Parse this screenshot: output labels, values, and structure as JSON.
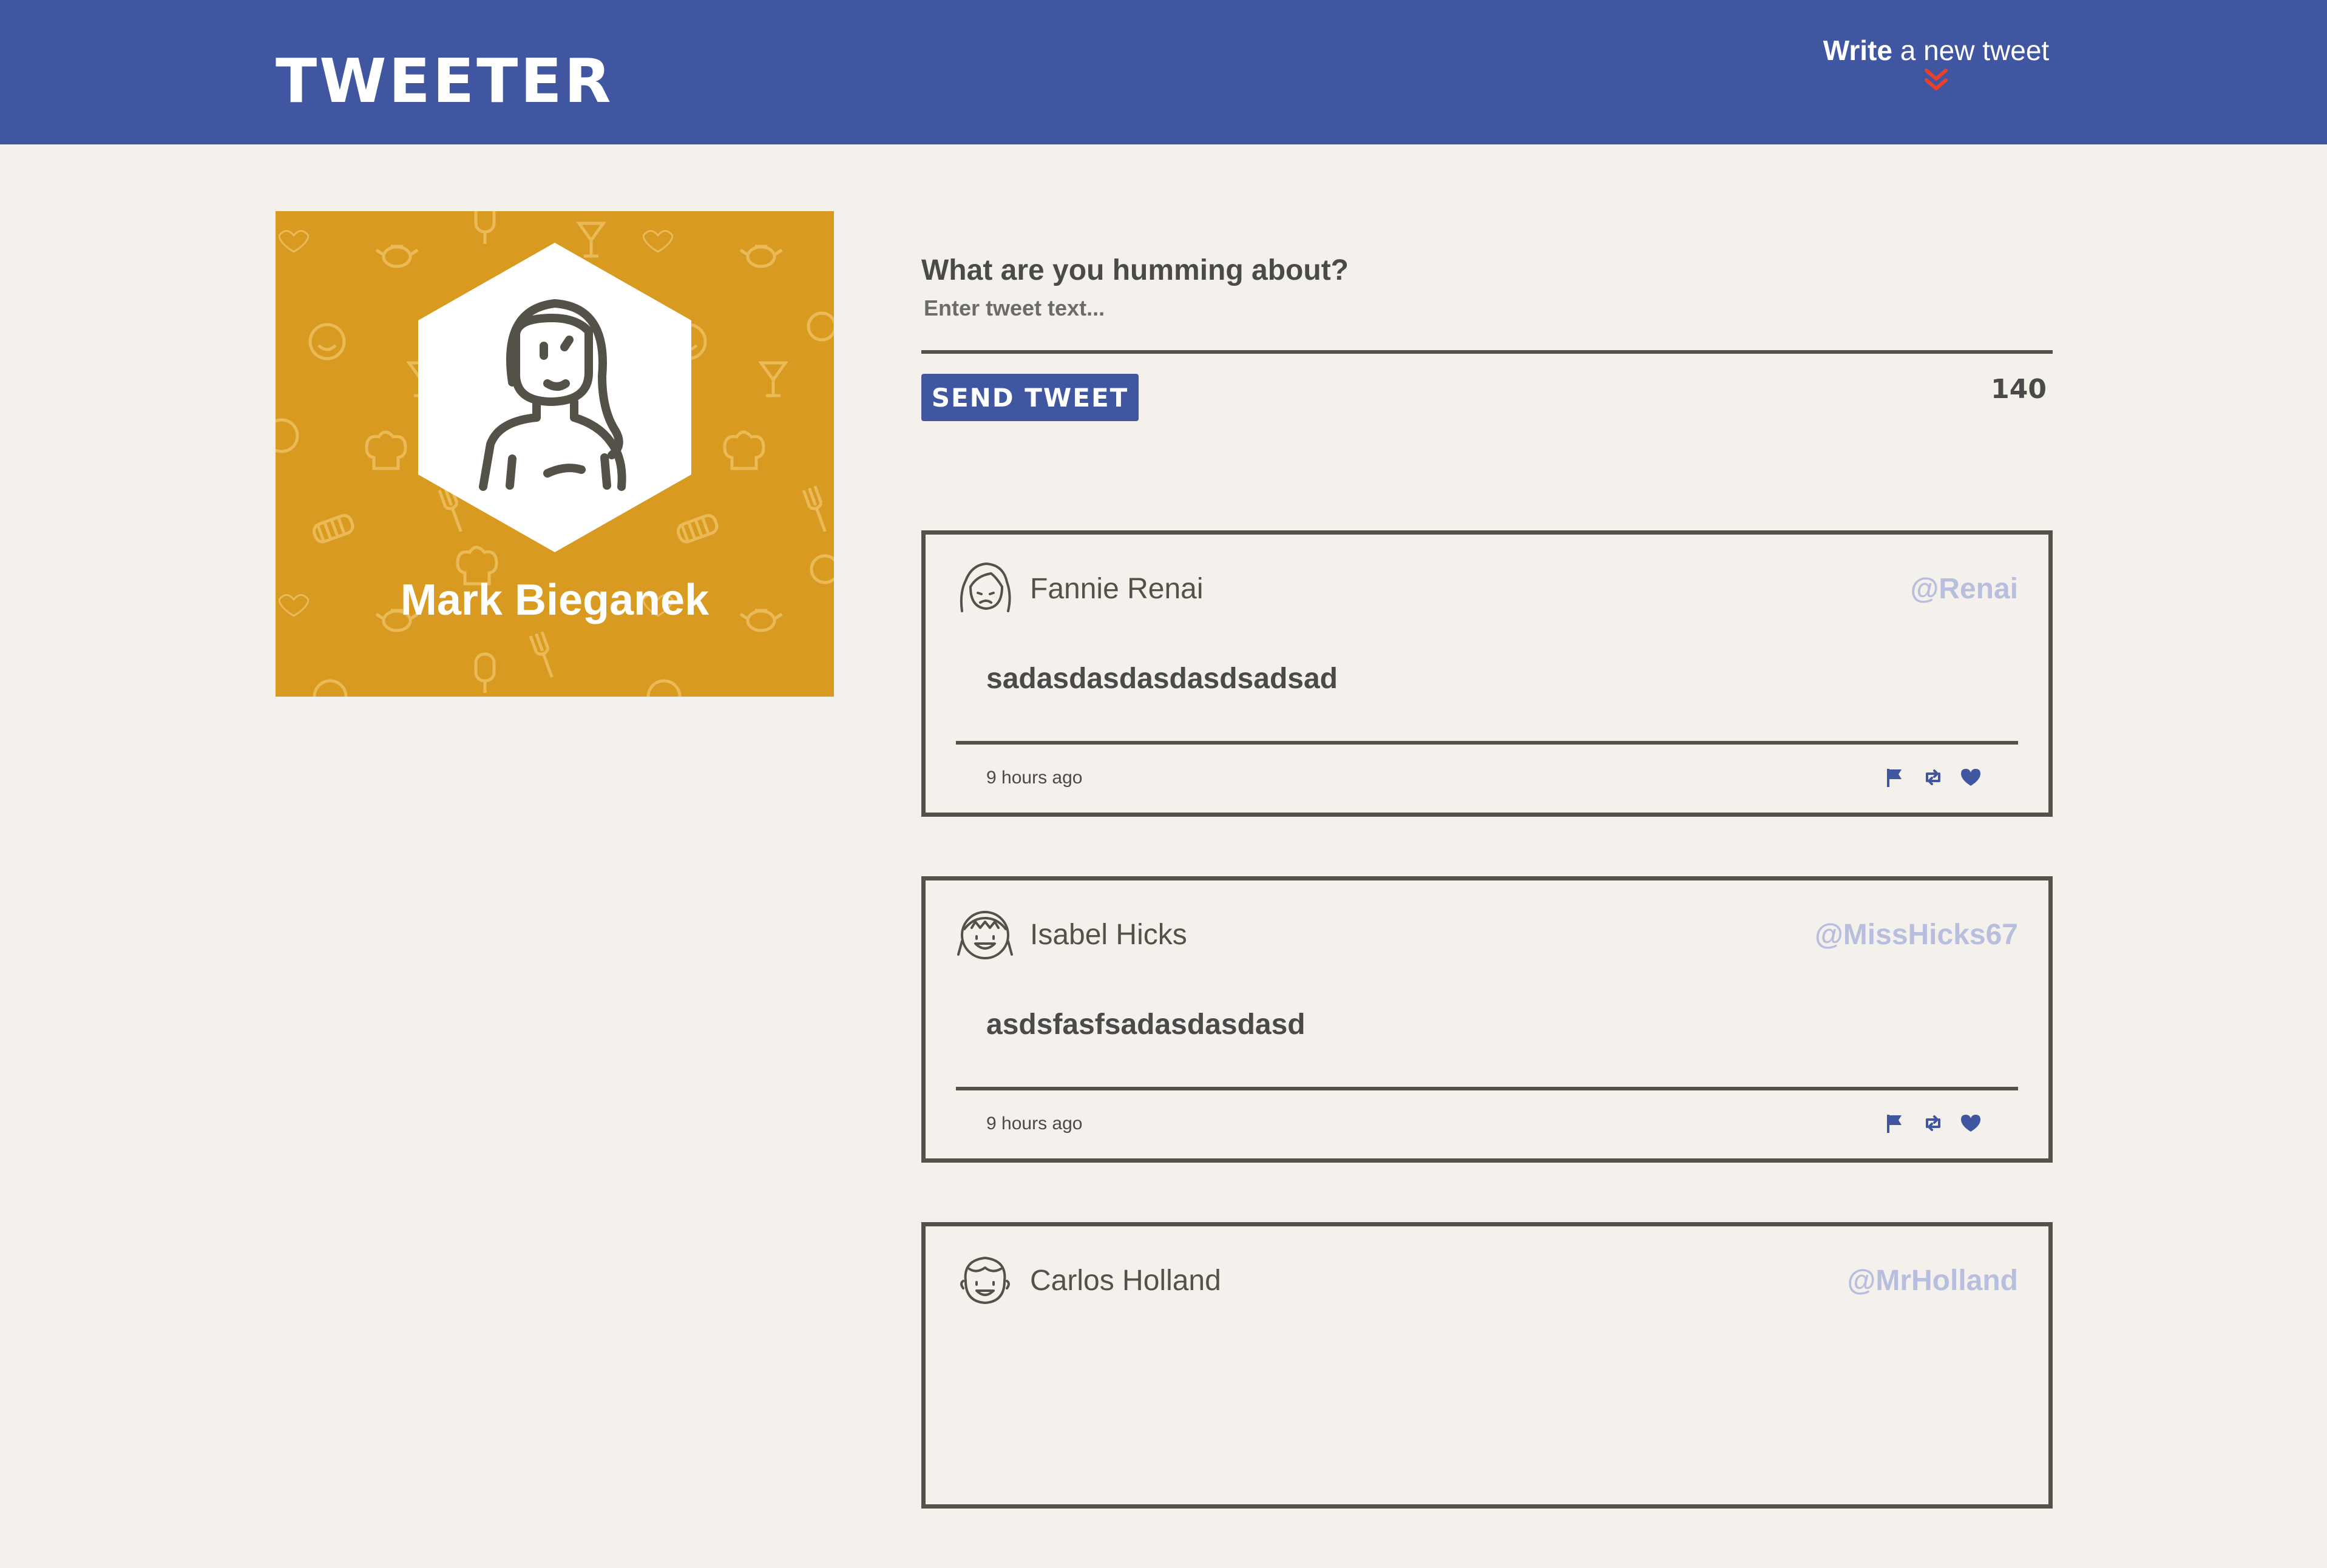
{
  "nav": {
    "brand": "TWEETER",
    "compose_bold": "Write",
    "compose_rest": " a new tweet",
    "compose_icon": "double-chevron-down-icon",
    "background": "#4056a1",
    "accent": "#e8412c"
  },
  "profile": {
    "name": "Mark Bieganek",
    "background": "#d89a20"
  },
  "composer": {
    "label": "What are you humming about?",
    "placeholder": "Enter tweet text...",
    "value": "",
    "send_label": "SEND TWEET",
    "counter": "140"
  },
  "tweets": [
    {
      "name": "Fannie Renai",
      "handle": "@Renai",
      "text": "sadasdasdasdasdsadsad",
      "time": "9 hours ago",
      "avatar": "woman-avatar-icon"
    },
    {
      "name": "Isabel Hicks",
      "handle": "@MissHicks67",
      "text": "asdsfasfsadasdasdasd",
      "time": "9 hours ago",
      "avatar": "girl-avatar-icon"
    },
    {
      "name": "Carlos Holland",
      "handle": "@MrHolland",
      "text": "",
      "time": "",
      "avatar": "man-avatar-icon"
    }
  ],
  "actions": [
    "flag-icon",
    "retweet-icon",
    "heart-icon"
  ]
}
